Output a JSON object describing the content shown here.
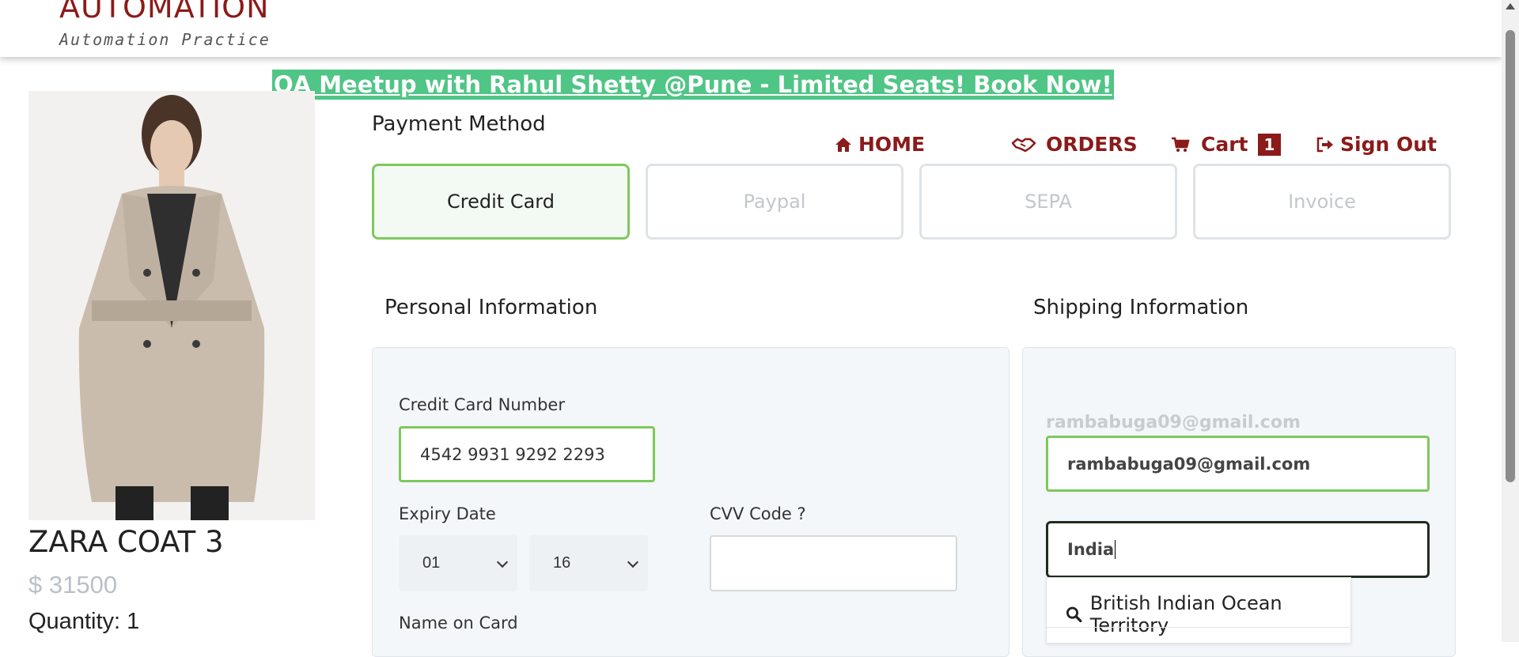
{
  "header": {
    "logo_title": "AUTOMATION",
    "logo_subtitle": "Automation Practice"
  },
  "banner": {
    "text": "QA Meetup with Rahul Shetty @Pune - Limited Seats! Book Now!"
  },
  "nav": {
    "home": "HOME",
    "orders": "ORDERS",
    "cart": "Cart",
    "cart_count": "1",
    "signout": "Sign Out"
  },
  "product": {
    "name": "ZARA COAT 3",
    "price": "$ 31500",
    "quantity": "Quantity: 1"
  },
  "payment": {
    "title": "Payment Method",
    "methods": [
      "Credit Card",
      "Paypal",
      "SEPA",
      "Invoice"
    ],
    "selected": "Credit Card"
  },
  "personal": {
    "title": "Personal Information",
    "card_label": "Credit Card Number",
    "card_value": "4542 9931 9292 2293",
    "expiry_label": "Expiry Date",
    "expiry_month": "01",
    "expiry_year": "16",
    "cvv_label": "CVV Code ?",
    "cvv_value": "",
    "name_label": "Name on Card"
  },
  "shipping": {
    "title": "Shipping Information",
    "email_label": "rambabuga09@gmail.com",
    "email_value": "rambabuga09@gmail.com",
    "country_value": "India",
    "suggestion": "British Indian Ocean Territory"
  },
  "colors": {
    "brand": "#8b1a1a",
    "banner_bg": "#4fc586",
    "selected_border": "#7dc95c"
  },
  "icons": {
    "home": "home-icon",
    "orders": "handshake-icon",
    "cart": "cart-icon",
    "signout": "sign-out-icon",
    "suggestion": "search-icon"
  }
}
